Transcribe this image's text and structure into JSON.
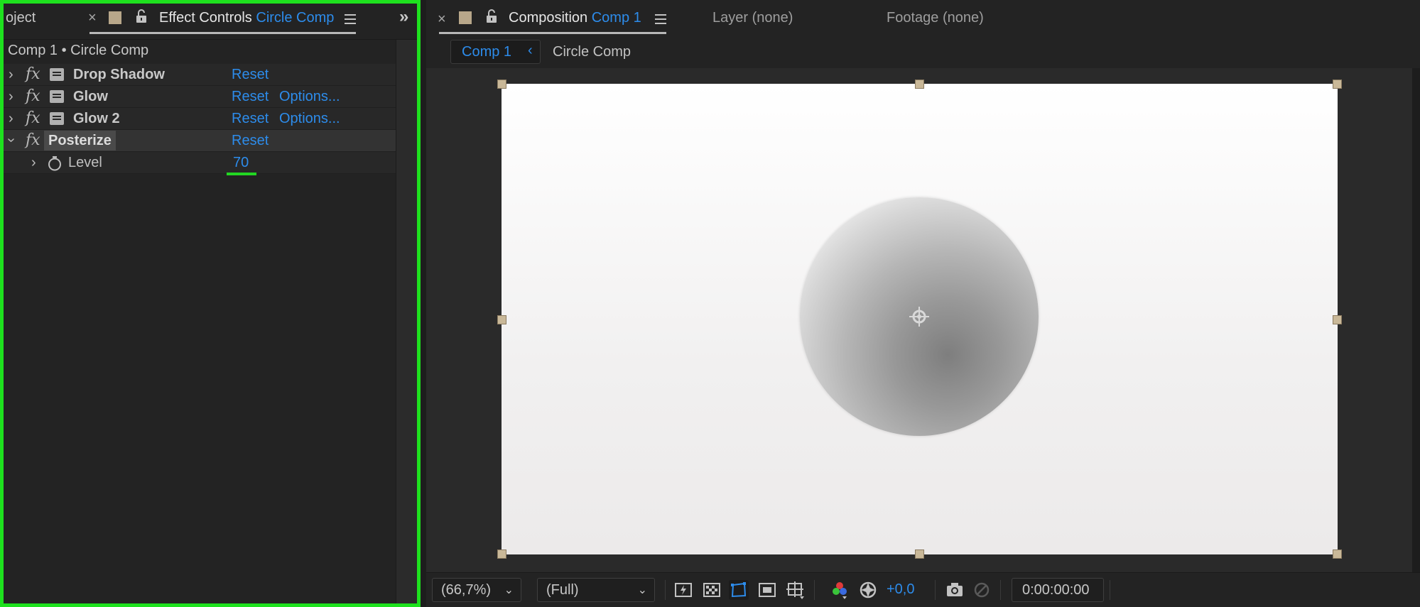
{
  "left_panel": {
    "project_tab_label": "oject",
    "effect_controls_tab": {
      "title": "Effect Controls",
      "layer": "Circle Comp"
    },
    "expand_glyph": "»",
    "breadcrumb": "Comp 1 • Circle Comp",
    "effects": [
      {
        "name": "Drop Shadow",
        "reset": "Reset",
        "options": ""
      },
      {
        "name": "Glow",
        "reset": "Reset",
        "options": "Options..."
      },
      {
        "name": "Glow 2",
        "reset": "Reset",
        "options": "Options..."
      },
      {
        "name": "Posterize",
        "reset": "Reset",
        "options": ""
      }
    ],
    "property": {
      "name": "Level",
      "value": "70"
    },
    "fx_label": "fx"
  },
  "composition_panel": {
    "tab_title": "Composition",
    "tab_comp": "Comp 1",
    "layer_tab": "Layer (none)",
    "footage_tab": "Footage (none)",
    "subtabs": [
      "Comp 1",
      "Circle Comp"
    ],
    "close_glyph": "×"
  },
  "viewer_toolbar": {
    "zoom": "(66,7%)",
    "resolution": "(Full)",
    "exposure": "+0,0",
    "timecode": "0:00:00:00"
  },
  "colors": {
    "accent_blue": "#2d8ceb",
    "highlight_green": "#1ee11e",
    "label_swatch": "#b8a78a"
  },
  "icons": {
    "effect_icon": "effect-preset-icon",
    "stopwatch": "stopwatch-icon",
    "lock": "lock-icon",
    "menu": "hamburger-menu-icon"
  }
}
